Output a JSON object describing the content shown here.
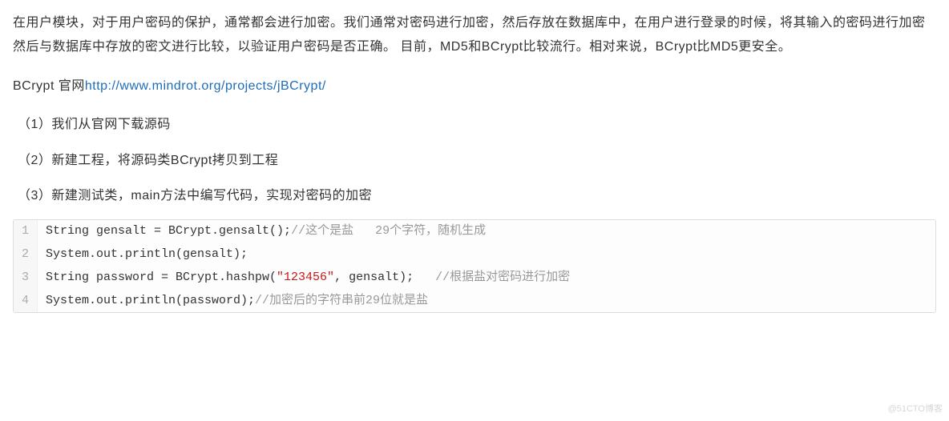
{
  "intro": "在用户模块，对于用户密码的保护，通常都会进行加密。我们通常对密码进行加密，然后存放在数据库中，在用户进行登录的时候，将其输入的密码进行加密然后与数据库中存放的密文进行比较，以验证用户密码是否正确。 目前，MD5和BCrypt比较流行。相对来说，BCrypt比MD5更安全。",
  "link_line": {
    "prefix": "BCrypt 官网",
    "url_text": "http://www.mindrot.org/projects/jBCrypt/",
    "href": "http://www.mindrot.org/projects/jBCrypt/"
  },
  "steps": [
    "（1）我们从官网下载源码",
    "（2）新建工程，将源码类BCrypt拷贝到工程",
    "（3）新建测试类，main方法中编写代码，实现对密码的加密"
  ],
  "code": {
    "lines": [
      {
        "n": "1",
        "segs": [
          {
            "t": "String gensalt = BCrypt.gensalt();",
            "c": ""
          },
          {
            "t": "//这个是盐   29个字符，随机生成",
            "c": "tok-cmt"
          }
        ]
      },
      {
        "n": "2",
        "segs": [
          {
            "t": "System.out.println(gensalt);",
            "c": ""
          }
        ]
      },
      {
        "n": "3",
        "segs": [
          {
            "t": "String password = BCrypt.hashpw(",
            "c": ""
          },
          {
            "t": "\"123456\"",
            "c": "tok-str"
          },
          {
            "t": ", gensalt);   ",
            "c": ""
          },
          {
            "t": "//根据盐对密码进行加密",
            "c": "tok-cmt"
          }
        ]
      },
      {
        "n": "4",
        "segs": [
          {
            "t": "System.out.println(password);",
            "c": ""
          },
          {
            "t": "//加密后的字符串前29位就是盐",
            "c": "tok-cmt"
          }
        ]
      }
    ]
  },
  "watermark": "@51CTO博客"
}
